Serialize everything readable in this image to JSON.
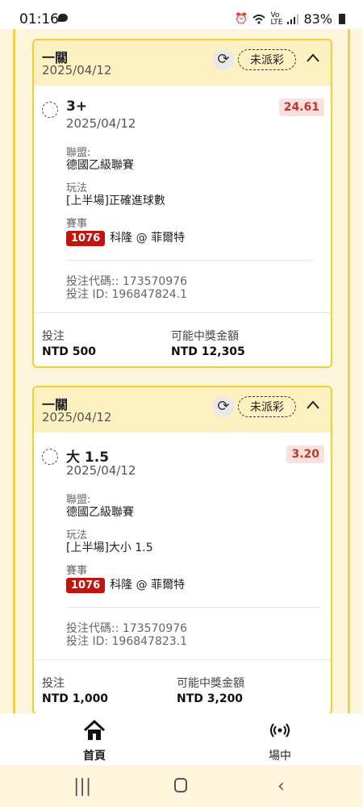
{
  "status_bar": {
    "time": "01:16",
    "battery": "83%"
  },
  "bets": [
    {
      "title": "一關",
      "date": "2025/04/12",
      "status": "未派彩",
      "selection": "3+",
      "selection_date": "2025/04/12",
      "odds": "24.61",
      "league_label": "聯盟:",
      "league": "德國乙級聯賽",
      "market_label": "玩法",
      "market": "[上半場]正確進球數",
      "event_label": "賽事",
      "match_no": "1076",
      "match": "科隆 @ 菲爾特",
      "code": "投注代碼:: 173570976",
      "bet_id": "投注 ID: 196847824.1",
      "stake_label": "投注",
      "stake": "NTD 500",
      "payout_label": "可能中獎金額",
      "payout": "NTD 12,305"
    },
    {
      "title": "一關",
      "date": "2025/04/12",
      "status": "未派彩",
      "selection": "大 1.5",
      "selection_date": "2025/04/12",
      "odds": "3.20",
      "league_label": "聯盟:",
      "league": "德國乙級聯賽",
      "market_label": "玩法",
      "market": "[上半場]大小 1.5",
      "event_label": "賽事",
      "match_no": "1076",
      "match": "科隆 @ 菲爾特",
      "code": "投注代碼:: 173570976",
      "bet_id": "投注 ID: 196847823.1",
      "stake_label": "投注",
      "stake": "NTD 1,000",
      "payout_label": "可能中獎金額",
      "payout": "NTD 3,200"
    }
  ],
  "nav": {
    "home": "首頁",
    "live": "場中"
  },
  "colors": {
    "accent": "#f1cf35",
    "odds": "#c0392b",
    "badge": "#c0150f"
  }
}
